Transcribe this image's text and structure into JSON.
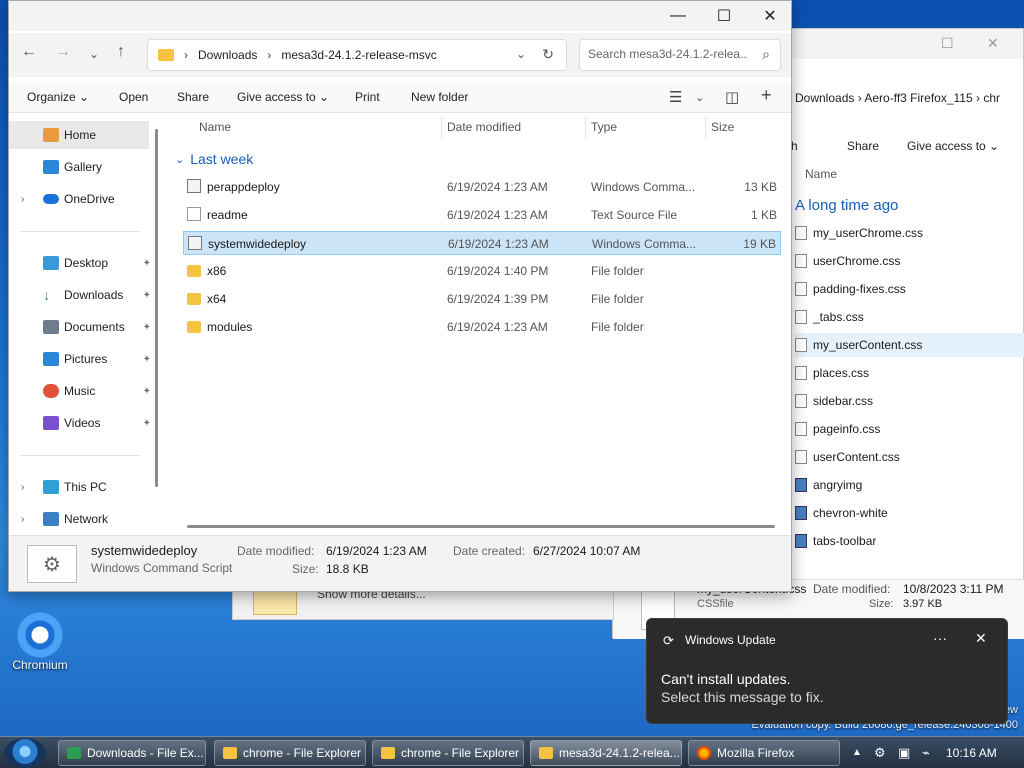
{
  "desktop": {
    "icon_label": "Chromium",
    "watermark_line1": "ew",
    "watermark_line2": "Evaluation copy. Build 26080.ge_release.240308-1400"
  },
  "background_window": {
    "address_crumbs": "Downloads  ›  Aero-ff3 Firefox_115  ›  chr",
    "commands": [
      "h",
      "Share",
      "Give access to"
    ],
    "column_name": "Name",
    "group": "A long time ago",
    "files": [
      {
        "name": "my_userChrome.css",
        "icon": "doc-icon"
      },
      {
        "name": "userChrome.css",
        "icon": "doc-icon"
      },
      {
        "name": "padding-fixes.css",
        "icon": "doc-icon"
      },
      {
        "name": "_tabs.css",
        "icon": "doc-icon"
      },
      {
        "name": "my_userContent.css",
        "icon": "doc-icon",
        "selected": true
      },
      {
        "name": "places.css",
        "icon": "doc-icon"
      },
      {
        "name": "sidebar.css",
        "icon": "doc-icon"
      },
      {
        "name": "pageinfo.css",
        "icon": "doc-icon"
      },
      {
        "name": "userContent.css",
        "icon": "doc-icon"
      },
      {
        "name": "angryimg",
        "icon": "image-icon"
      },
      {
        "name": "chevron-white",
        "icon": "image-icon"
      },
      {
        "name": "tabs-toolbar",
        "icon": "image-icon"
      }
    ],
    "details": {
      "name": "my_userContent.css",
      "type": "CSSfile",
      "modified_label": "Date modified:",
      "modified_value": "10/8/2023 3:11 PM",
      "size_label": "Size:",
      "size_value": "3.97 KB"
    }
  },
  "middle_window": {
    "show_more": "Show more details..."
  },
  "main_window": {
    "address": {
      "crumbs": [
        "Downloads",
        "mesa3d-24.1.2-release-msvc"
      ]
    },
    "search": {
      "placeholder": "Search mesa3d-24.1.2-relea..."
    },
    "commands": {
      "organize": "Organize",
      "open": "Open",
      "share": "Share",
      "give_access": "Give access to",
      "print": "Print",
      "new_folder": "New folder"
    },
    "sidebar": {
      "items": [
        {
          "label": "Home"
        },
        {
          "label": "Gallery"
        },
        {
          "label": "OneDrive"
        },
        {
          "label": "Desktop"
        },
        {
          "label": "Downloads"
        },
        {
          "label": "Documents"
        },
        {
          "label": "Pictures"
        },
        {
          "label": "Music"
        },
        {
          "label": "Videos"
        },
        {
          "label": "This PC"
        },
        {
          "label": "Network"
        }
      ]
    },
    "columns": {
      "name": "Name",
      "date_modified": "Date modified",
      "type": "Type",
      "size": "Size"
    },
    "group_label": "Last week",
    "files": [
      {
        "name": "perappdeploy",
        "date": "6/19/2024 1:23 AM",
        "type": "Windows Comma...",
        "size": "13 KB",
        "kind": "script"
      },
      {
        "name": "readme",
        "date": "6/19/2024 1:23 AM",
        "type": "Text Source File",
        "size": "1 KB",
        "kind": "text"
      },
      {
        "name": "systemwidedeploy",
        "date": "6/19/2024 1:23 AM",
        "type": "Windows Comma...",
        "size": "19 KB",
        "kind": "script",
        "selected": true
      },
      {
        "name": "x86",
        "date": "6/19/2024 1:40 PM",
        "type": "File folder",
        "size": "",
        "kind": "folder"
      },
      {
        "name": "x64",
        "date": "6/19/2024 1:39 PM",
        "type": "File folder",
        "size": "",
        "kind": "folder"
      },
      {
        "name": "modules",
        "date": "6/19/2024 1:23 AM",
        "type": "File folder",
        "size": "",
        "kind": "folder"
      }
    ],
    "details": {
      "name": "systemwidedeploy",
      "type": "Windows Command Script",
      "modified_label": "Date modified:",
      "modified_value": "6/19/2024 1:23 AM",
      "created_label": "Date created:",
      "created_value": "6/27/2024 10:07 AM",
      "size_label": "Size:",
      "size_value": "18.8 KB"
    }
  },
  "notification": {
    "title": "Windows Update",
    "message": "Can't install updates.",
    "submessage": "Select this message to fix."
  },
  "taskbar": {
    "tasks": [
      {
        "label": "Downloads - File Ex..."
      },
      {
        "label": "chrome - File Explorer"
      },
      {
        "label": "chrome - File Explorer"
      },
      {
        "label": "mesa3d-24.1.2-relea..."
      },
      {
        "label": "Mozilla Firefox"
      }
    ],
    "clock": "10:16 AM"
  }
}
